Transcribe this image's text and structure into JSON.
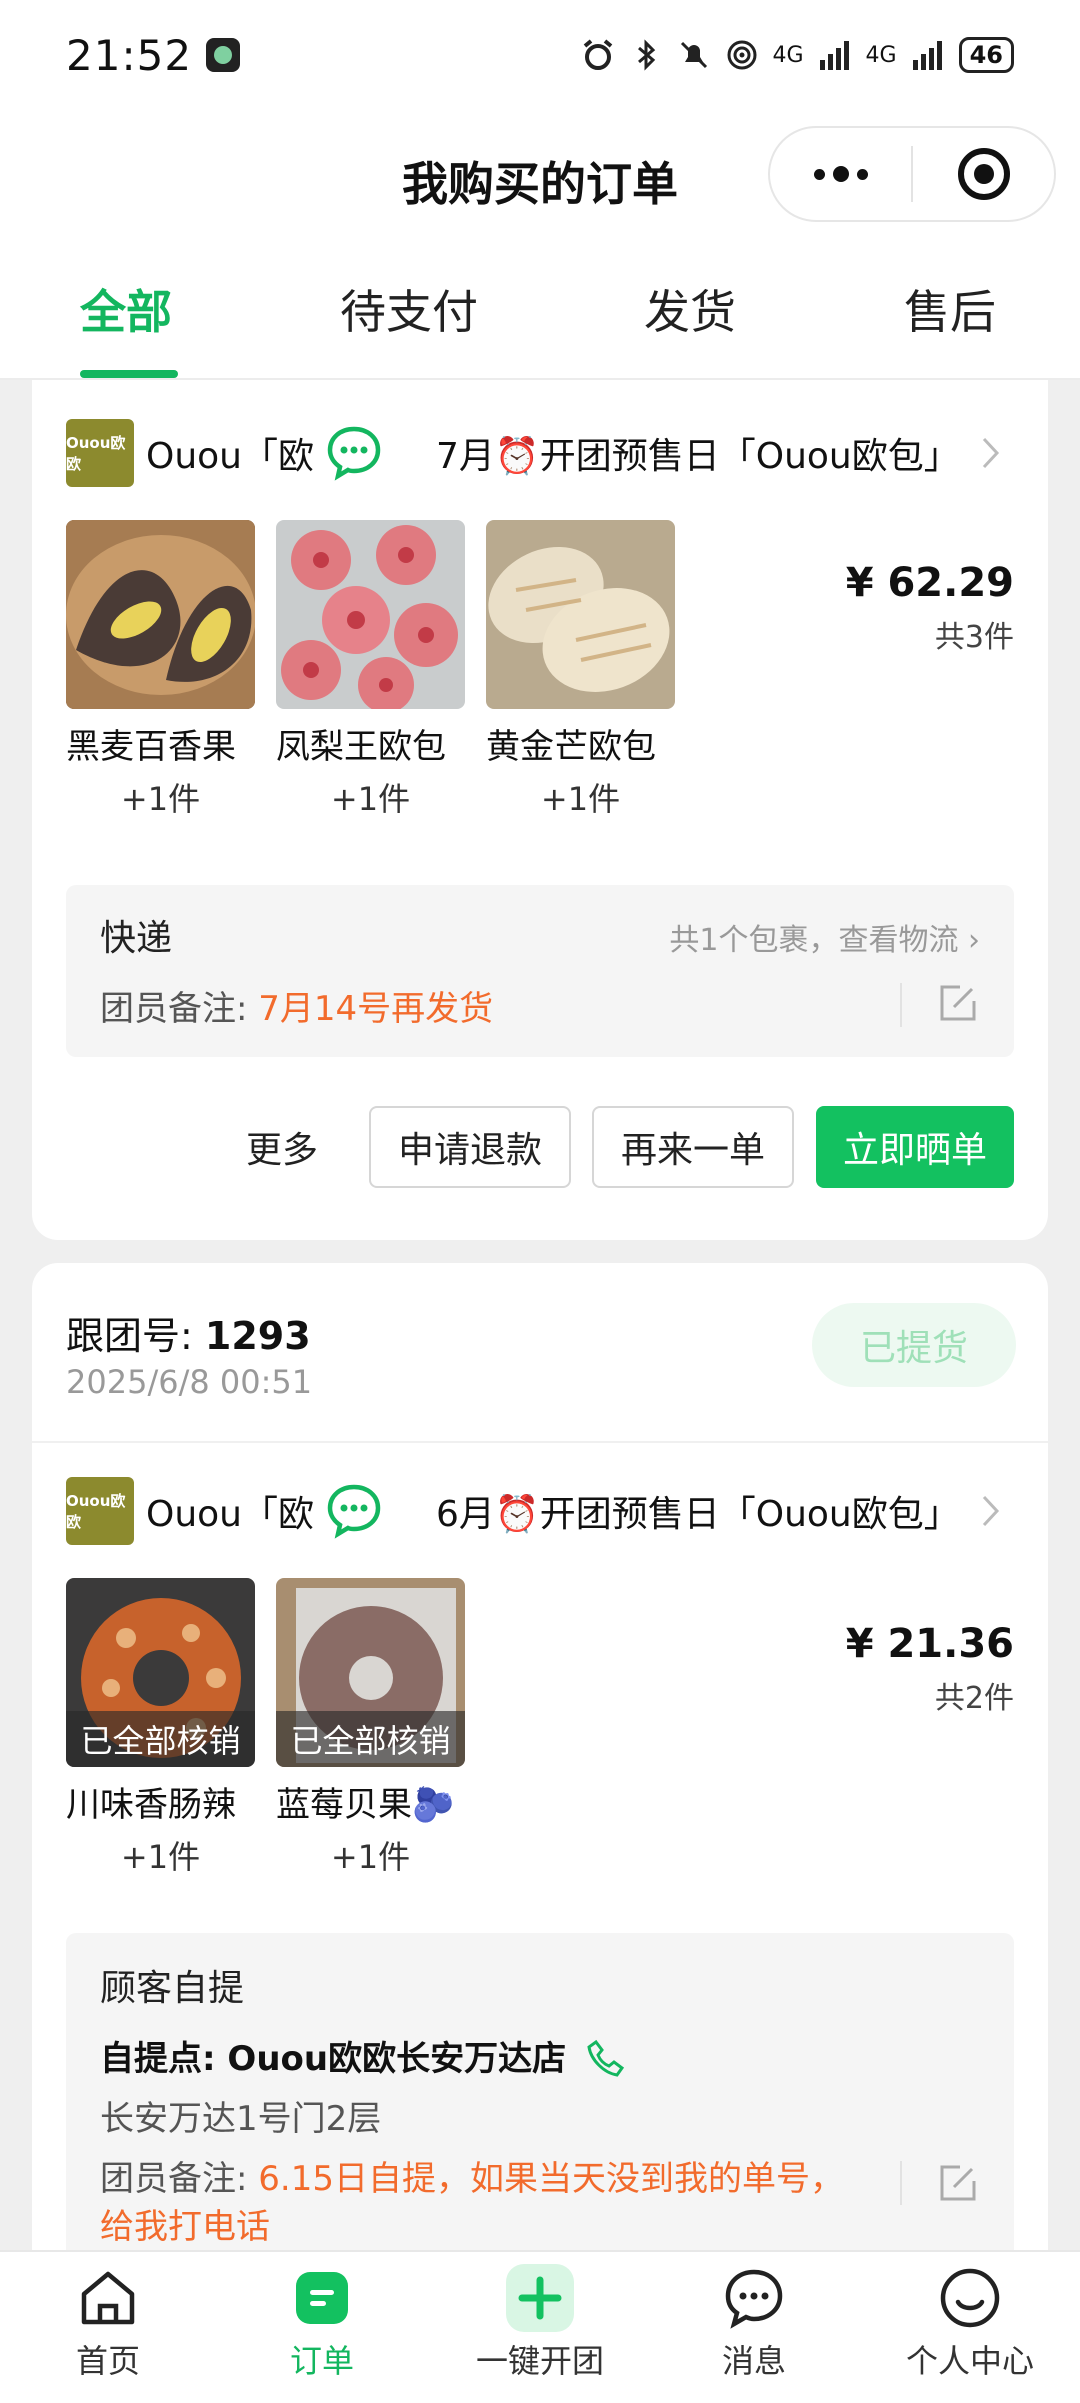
{
  "status_bar": {
    "time": "21:52",
    "network_1": "4G",
    "network_2": "4G",
    "battery": "46"
  },
  "header": {
    "title": "我购买的订单"
  },
  "tabs": [
    {
      "label": "全部",
      "active": true
    },
    {
      "label": "待支付",
      "active": false
    },
    {
      "label": "发货",
      "active": false
    },
    {
      "label": "售后",
      "active": false
    }
  ],
  "orders": [
    {
      "store_name": "Ouou「欧欧",
      "store_logo_text": "Ouou欧欧",
      "activity": "7月⏰开团预售日「Ouou欧包」",
      "products": [
        {
          "name": "黑麦百香果",
          "qty": "+1件"
        },
        {
          "name": "凤梨王欧包",
          "qty": "+1件"
        },
        {
          "name": "黄金芒欧包",
          "qty": "+1件"
        }
      ],
      "price": "¥ 62.29",
      "count": "共3件",
      "delivery_title": "快递",
      "delivery_link": "共1个包裹，查看物流",
      "note_label": "团员备注: ",
      "note_value": "7月14号再发货",
      "buttons": {
        "more": "更多",
        "refund": "申请退款",
        "reorder": "再来一单",
        "share": "立即晒单"
      }
    },
    {
      "group_label": "跟团号: ",
      "group_no": "1293",
      "date": "2025/6/8 00:51",
      "status": "已提货",
      "store_name": "Ouou「欧欧",
      "store_logo_text": "Ouou欧欧",
      "activity": "6月⏰开团预售日「Ouou欧包」",
      "products": [
        {
          "name": "川味香肠辣",
          "qty": "+1件",
          "overlay": "已全部核销"
        },
        {
          "name": "蓝莓贝果🫐",
          "qty": "+1件",
          "overlay": "已全部核销"
        }
      ],
      "price": "¥ 21.36",
      "count": "共2件",
      "delivery_title": "顾客自提",
      "pickup_point": "自提点: Ouou欧欧长安万达店",
      "pickup_address": "长安万达1号门2层",
      "note_label": "团员备注: ",
      "note_value": "6.15日自提，如果当天没到我的单号，给我打电话"
    }
  ],
  "bottom_nav": [
    {
      "label": "首页",
      "icon": "home-icon"
    },
    {
      "label": "订单",
      "icon": "order-icon"
    },
    {
      "label": "一键开团",
      "icon": "plus-icon"
    },
    {
      "label": "消息",
      "icon": "message-icon"
    },
    {
      "label": "个人中心",
      "icon": "profile-icon"
    }
  ],
  "colors": {
    "accent": "#13b65f",
    "primary_button": "#13c160",
    "note": "#f26b2c"
  }
}
